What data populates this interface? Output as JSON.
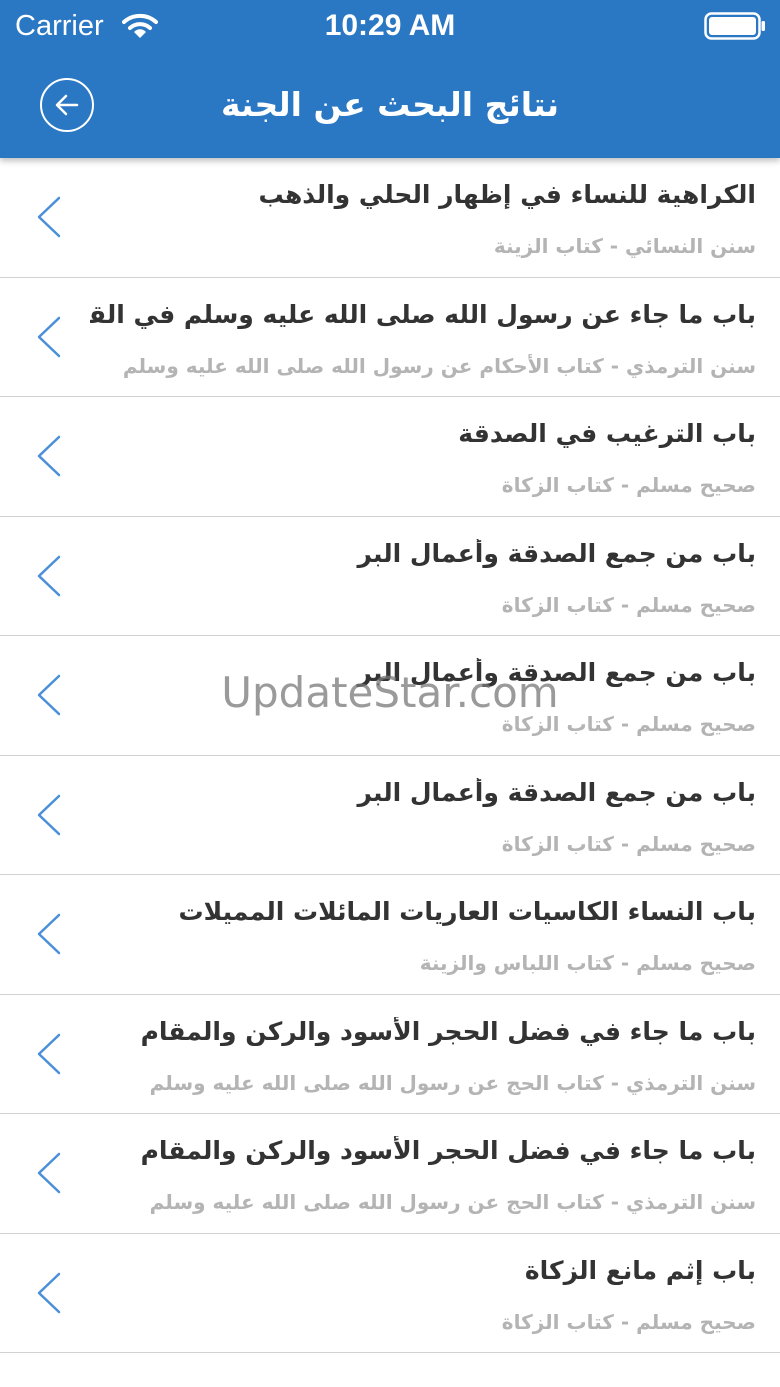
{
  "status_bar": {
    "carrier": "Carrier",
    "time": "10:29 AM"
  },
  "nav": {
    "title": "نتائج البحث عن الجنة",
    "back_icon": "arrow-left-circle-icon"
  },
  "results": [
    {
      "title": "الكراهية للنساء في إظهار الحلي والذهب",
      "subtitle": "سنن النسائي - كتاب الزينة"
    },
    {
      "title": "باب ما جاء عن رسول الله صلى الله عليه وسلم في القاضي",
      "subtitle": "سنن الترمذي - كتاب الأحكام عن رسول الله صلى الله عليه وسلم"
    },
    {
      "title": "باب الترغيب في الصدقة",
      "subtitle": "صحيح مسلم - كتاب الزكاة"
    },
    {
      "title": "باب من جمع الصدقة وأعمال البر",
      "subtitle": "صحيح مسلم - كتاب الزكاة"
    },
    {
      "title": "باب من جمع الصدقة وأعمال البر",
      "subtitle": "صحيح مسلم - كتاب الزكاة"
    },
    {
      "title": "باب من جمع الصدقة وأعمال البر",
      "subtitle": "صحيح مسلم - كتاب الزكاة"
    },
    {
      "title": "باب النساء الكاسيات العاريات المائلات المميلات",
      "subtitle": "صحيح مسلم - كتاب اللباس والزينة"
    },
    {
      "title": "باب ما جاء في فضل الحجر الأسود والركن والمقام",
      "subtitle": "سنن الترمذي - كتاب الحج عن رسول الله صلى الله عليه وسلم"
    },
    {
      "title": "باب ما جاء في فضل الحجر الأسود والركن والمقام",
      "subtitle": "سنن الترمذي - كتاب الحج عن رسول الله صلى الله عليه وسلم"
    },
    {
      "title": "باب إثم مانع الزكاة",
      "subtitle": "صحيح مسلم - كتاب الزكاة"
    }
  ],
  "watermark": "UpdateStar.com",
  "colors": {
    "header": "#2a77c4",
    "chevron": "#4a90d9",
    "title_text": "#333333",
    "subtitle_text": "#b4b4b4",
    "divider": "#d2d2d2"
  }
}
